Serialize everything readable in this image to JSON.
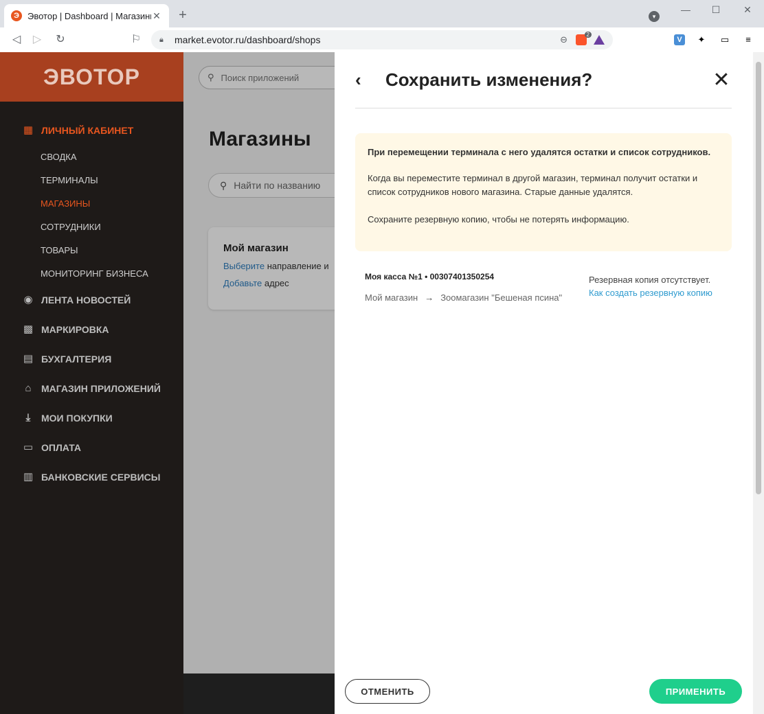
{
  "browser": {
    "tab_title": "Эвотор | Dashboard | Магазины",
    "tab_favicon": "Э",
    "url": "market.evotor.ru/dashboard/shops",
    "brave_badge": "2",
    "ext_v": "V"
  },
  "sidebar": {
    "logo": "ЭВОТОР",
    "sections": [
      {
        "label": "ЛИЧНЫЙ КАБИНЕТ",
        "icon": "grid-icon",
        "active": true
      },
      {
        "label": "ЛЕНТА НОВОСТЕЙ",
        "icon": "news-icon"
      },
      {
        "label": "МАРКИРОВКА",
        "icon": "qr-icon"
      },
      {
        "label": "БУХГАЛТЕРИЯ",
        "icon": "ledger-icon"
      },
      {
        "label": "МАГАЗИН ПРИЛОЖЕНИЙ",
        "icon": "store-icon"
      },
      {
        "label": "МОИ ПОКУПКИ",
        "icon": "download-icon"
      },
      {
        "label": "ОПЛАТА",
        "icon": "card-icon"
      },
      {
        "label": "БАНКОВСКИЕ СЕРВИСЫ",
        "icon": "bank-icon"
      }
    ],
    "subitems": [
      "СВОДКА",
      "ТЕРМИНАЛЫ",
      "МАГАЗИНЫ",
      "СОТРУДНИКИ",
      "ТОВАРЫ",
      "МОНИТОРИНГ БИЗНЕСА"
    ],
    "active_subitem": "МАГАЗИНЫ"
  },
  "main": {
    "app_search_placeholder": "Поиск приложений",
    "page_title": "Магазины",
    "shop_search_placeholder": "Найти по названию",
    "shop_card": {
      "title": "Мой магазин",
      "line1_link": "Выберите",
      "line1_text": "направление и",
      "line2_link": "Добавьте",
      "line2_text": "адрес"
    }
  },
  "modal": {
    "title": "Сохранить изменения?",
    "warning_bold": "При перемещении терминала с него удалятся остатки и список сотрудников.",
    "warning_p1": "Когда вы переместите терминал в другой магазин, терминал получит остатки и список сотрудников нового магазина. Старые данные удалятся.",
    "warning_p2": "Сохраните резервную копию, чтобы не потерять информацию.",
    "terminal_name": "Моя касса №1 • 00307401350254",
    "from_shop": "Мой магазин",
    "to_shop": "Зоомагазин \"Бешеная псина\"",
    "backup_status": "Резервная копия отсутствует.",
    "backup_link": "Как создать резервную копию",
    "cancel_label": "ОТМЕНИТЬ",
    "apply_label": "ПРИМЕНИТЬ"
  },
  "colors": {
    "brand": "#e8561f",
    "apply": "#1fcf8c",
    "link": "#2f9bcf"
  }
}
